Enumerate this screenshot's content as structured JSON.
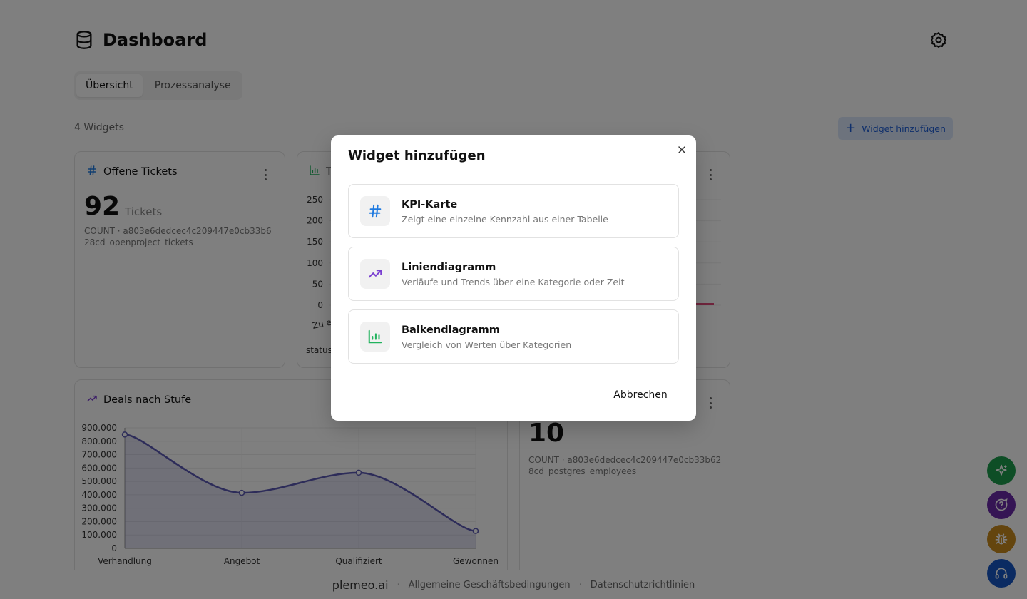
{
  "header": {
    "title": "Dashboard"
  },
  "tabs": [
    {
      "label": "Übersicht",
      "active": true
    },
    {
      "label": "Prozessanalyse",
      "active": false
    }
  ],
  "toolbar": {
    "widget_count": "4 Widgets",
    "add_widget_label": "Widget hinzufügen"
  },
  "widgets": {
    "open_tickets": {
      "title": "Offene Tickets",
      "value": "92",
      "unit": "Tickets",
      "meta": "COUNT · a803e6dedcec4c209447e0cb33b628cd_openproject_tickets"
    },
    "tickets_chart": {
      "title_fragment": "T",
      "x_tick_fragment": "Zu er",
      "x_label_fragment": "status",
      "chart_data": {
        "type": "bar",
        "ylim": [
          0,
          250
        ],
        "y_ticks": [
          "250",
          "200",
          "150",
          "100",
          "50",
          "0"
        ]
      }
    },
    "deals": {
      "title": "Deals nach Stufe",
      "chart_data": {
        "type": "area",
        "categories": [
          "Verhandlung",
          "Angebot",
          "Qualifiziert",
          "Gewonnen"
        ],
        "values": [
          850000,
          415000,
          565000,
          130000
        ],
        "ylim": [
          0,
          900000
        ],
        "y_ticks": [
          "900.000",
          "800.000",
          "700.000",
          "600.000",
          "500.000",
          "400.000",
          "300.000",
          "200.000",
          "100.000",
          "0"
        ],
        "color": "#5b58b3"
      }
    },
    "employees": {
      "value": "10",
      "meta": "COUNT · a803e6dedcec4c209447e0cb33b628cd_postgres_employees"
    }
  },
  "modal": {
    "title": "Widget hinzufügen",
    "options": [
      {
        "title": "KPI-Karte",
        "desc": "Zeigt eine einzelne Kennzahl aus einer Tabelle",
        "icon": "hash-icon",
        "color": "#1f7ae0"
      },
      {
        "title": "Liniendiagramm",
        "desc": "Verläufe und Trends über eine Kategorie oder Zeit",
        "icon": "trend-icon",
        "color": "#7a3fd1"
      },
      {
        "title": "Balkendiagramm",
        "desc": "Vergleich von Werten über Kategorien",
        "icon": "bar-chart-icon",
        "color": "#22b35e"
      }
    ],
    "cancel_label": "Abbrechen"
  },
  "footer": {
    "brand": "plemeo.ai",
    "links": [
      "Allgemeine Geschäftsbedingungen",
      "Datenschutzrichtlinien"
    ]
  },
  "fabs": [
    {
      "icon": "sparkle-icon",
      "color": "#1c9c4c"
    },
    {
      "icon": "chat-help-icon",
      "color": "#6a2aa8"
    },
    {
      "icon": "bug-icon",
      "color": "#c98a1c"
    },
    {
      "icon": "headset-icon",
      "color": "#1656c4"
    }
  ]
}
